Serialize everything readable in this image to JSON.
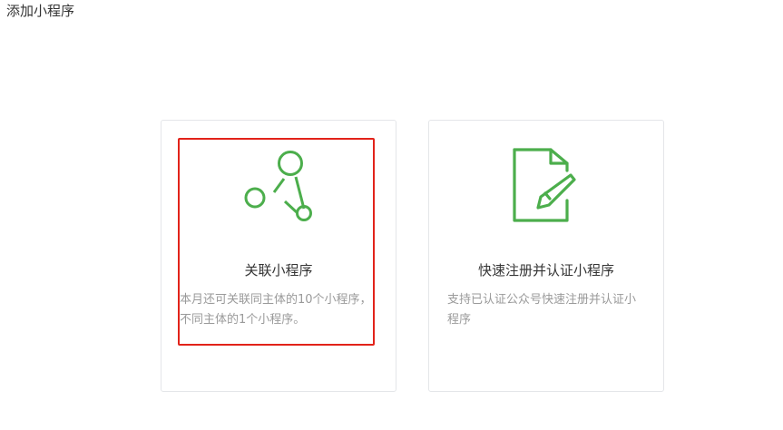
{
  "page": {
    "title": "添加小程序"
  },
  "cards": [
    {
      "title": "关联小程序",
      "desc": "本月还可关联同主体的10个小程序，不同主体的1个小程序。",
      "icon": "network-nodes-icon"
    },
    {
      "title": "快速注册并认证小程序",
      "desc": "支持已认证公众号快速注册并认证小程序",
      "icon": "document-edit-icon"
    }
  ],
  "colors": {
    "icon_green": "#4cae4c",
    "highlight_red": "#e2231a",
    "border": "#e4e6e9"
  }
}
